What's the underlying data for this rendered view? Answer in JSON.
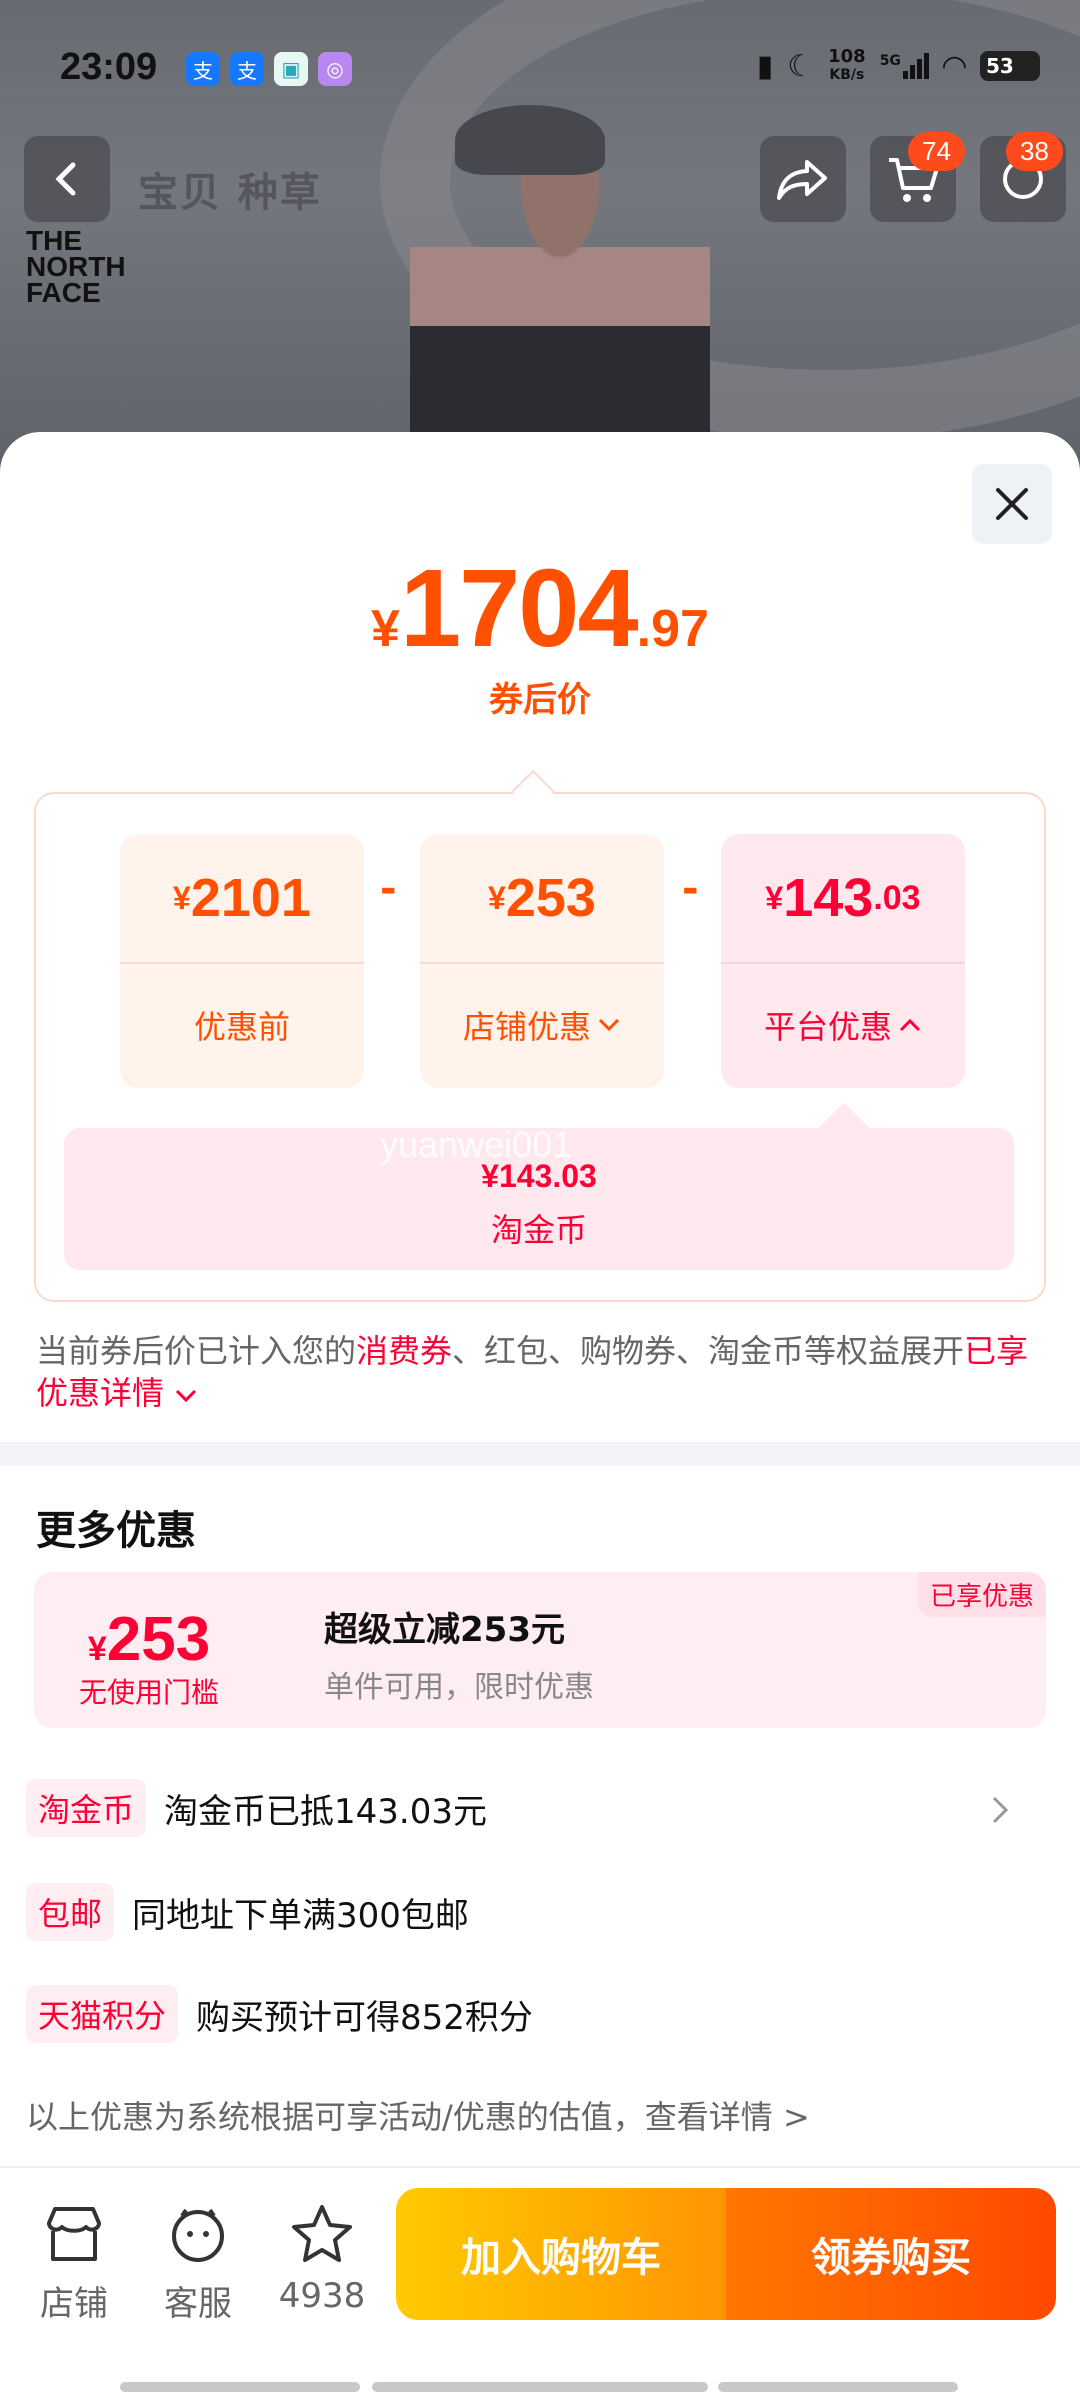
{
  "status_bar": {
    "time": "23:09",
    "net_speed": "108",
    "net_unit": "KB/s",
    "signal": "5G",
    "battery": "53"
  },
  "header": {
    "tabs_text": "宝贝 种草",
    "cart_badge": "74",
    "msg_badge": "38",
    "brand_logo_line1": "THE",
    "brand_logo_line2": "NORTH",
    "brand_logo_line3": "FACE"
  },
  "price": {
    "yen": "¥",
    "int": "1704",
    "dec": ".97",
    "label": "券后价"
  },
  "breakdown": [
    {
      "yen": "¥",
      "num": "2101",
      "dec": "",
      "label": "优惠前"
    },
    {
      "yen": "¥",
      "num": "253",
      "dec": "",
      "label": "店铺优惠"
    },
    {
      "yen": "¥",
      "num": "143",
      "dec": ".03",
      "label": "平台优惠"
    }
  ],
  "operators": [
    "-",
    "-"
  ],
  "platform_detail": {
    "value": "¥143.03",
    "label": "淘金币"
  },
  "watermark": "yuanwei001",
  "note": {
    "part1": "当前券后价已计入您的",
    "hl1": "消费券",
    "part2": "、红包、购物券、淘金币等权益展开",
    "hl2": "已享优惠详情"
  },
  "more": {
    "title": "更多优惠",
    "coupon": {
      "yen": "¥",
      "amount": "253",
      "threshold": "无使用门槛",
      "title": "超级立减253元",
      "desc": "单件可用，限时优惠",
      "tag": "已享优惠"
    },
    "rows": [
      {
        "pill": "淘金币",
        "text": "淘金币已抵143.03元"
      },
      {
        "pill": "包邮",
        "text": "同地址下单满300包邮"
      },
      {
        "pill": "天猫积分",
        "text": "购买预计可得852积分"
      }
    ],
    "footnote": "以上优惠为系统根据可享活动/优惠的估值，查看详情 >"
  },
  "bottom": {
    "store": "店铺",
    "service": "客服",
    "favorites": "4938",
    "add_cart": "加入购物车",
    "buy": "领券购买"
  },
  "colors": {
    "accent_orange": "#ff5000",
    "accent_red": "#ff0036"
  }
}
